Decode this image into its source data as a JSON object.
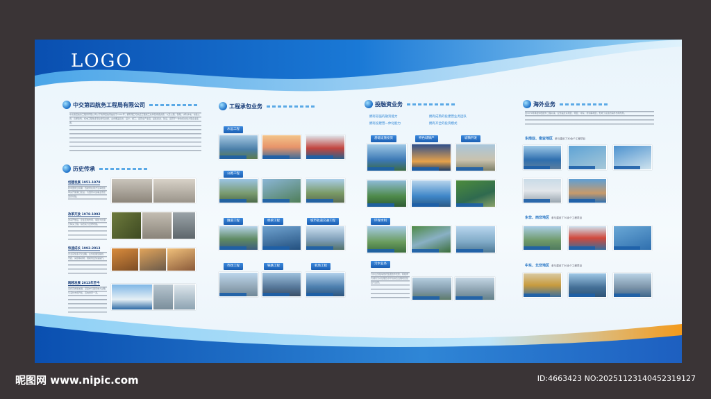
{
  "logo": "LOGO",
  "company": {
    "title": "中交第四航务工程局有限公司",
    "intro": "中交第四航务工程局有限公司以下简称四航局始创于1951年，拥有港口与航道工程施工总承包特级资质，以及公路、铁路、水利水电、市政公用、房屋建筑、机电工程等多项总承包资质，业务覆盖投资、设计、施工、运营全产业链，是集投资、建设、运营于一体的综合性大型企业集团。"
  },
  "history": {
    "title": "历史传承",
    "phases": [
      {
        "label": "创建发展 1951-1978",
        "text": "新中国成立初期，四航局在南方沿海地区率先开展港口建设，为国家水运事业奠定坚实基础。"
      },
      {
        "label": "改革开放 1978-1992",
        "text": "改革开放后，企业走向市场，承建大批港口码头工程，综合实力显著增强。"
      },
      {
        "label": "快速成长 1992-2013",
        "text": "企业实施多元化战略，业务拓展至路桥、市政、房建等领域，规模效益快速提升。"
      },
      {
        "label": "跨越发展 2013年至今",
        "text": "坚持高质量发展，深度参与国家重大战略与海外市场开拓，迈向世界一流。"
      }
    ]
  },
  "engineering": {
    "title": "工程承包业务",
    "categories": [
      "水运工程",
      "公路工程",
      "隧道工程",
      "桥梁工程",
      "城市轨道交通工程",
      "市政工程",
      "铁路工程",
      "机场工程"
    ]
  },
  "investment": {
    "title": "投融资业务",
    "bullets": [
      "拥有较强的融资能力",
      "拥有成熟的投建营业务团队",
      "拥有投建营一体化能力",
      "拥有齐全的投资模式"
    ],
    "tags": [
      "基础设施投资",
      "特色城镇产",
      "城镇开发",
      "环保水利",
      "污水业务"
    ],
    "note": "污水业务板块依托集团技术优势，积极参与城市污水处理及水环境综合治理项目建设与运营。"
  },
  "overseas": {
    "title": "海外业务",
    "intro": "自1979年承建中国援外工程以来，业务遍及东南亚、南亚、中东、非洲等地区，形成了完善的海外市场布局。",
    "regions": [
      {
        "name": "东南亚、南亚地区",
        "note": "参与建设了30余个工程项目"
      },
      {
        "name": "东非、西非地区",
        "note": "参与建设了70余个工程项目"
      },
      {
        "name": "中东、北非地区",
        "note": "参与建设了30余个工程项目"
      }
    ]
  },
  "watermark": {
    "left": "昵图网 www.nipic.com",
    "right": "ID:4663423 NO:20251123140452319127"
  },
  "colors": {
    "deep_blue": "#0a4fb0",
    "mid_blue": "#2f86d6",
    "light_blue": "#8fd0f5",
    "frame": "#3a3436",
    "orange": "#f39a1c"
  }
}
